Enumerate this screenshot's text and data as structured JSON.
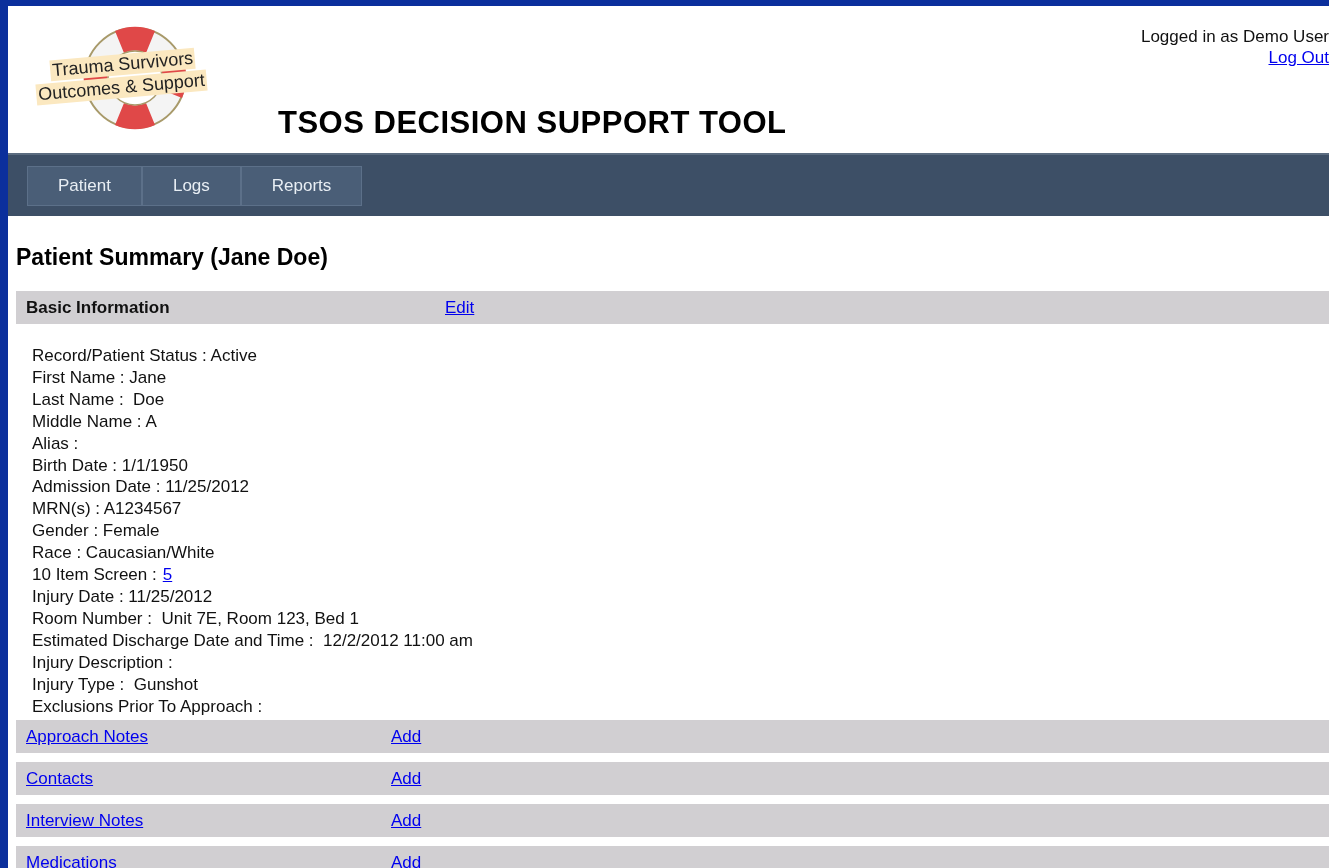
{
  "logo": {
    "line_1": "Trauma Survivors",
    "line_2": "Outcomes & Support"
  },
  "title": "TSOS DECISION SUPPORT TOOL",
  "user": {
    "status": "Logged in as Demo User",
    "logout": "Log Out"
  },
  "nav": [
    {
      "label": "Patient"
    },
    {
      "label": "Logs"
    },
    {
      "label": "Reports"
    }
  ],
  "heading": "Patient Summary (Jane Doe)",
  "basic_info": {
    "title": "Basic Information",
    "action": "Edit",
    "fields": [
      {
        "text": "Record/Patient Status : Active"
      },
      {
        "text": "First Name : Jane"
      },
      {
        "text": "Last Name :  Doe"
      },
      {
        "text": "Middle Name : A"
      },
      {
        "text": "Alias :"
      },
      {
        "text": "Birth Date : 1/1/1950"
      },
      {
        "text": "Admission Date : 11/25/2012"
      },
      {
        "text": "MRN(s) : A1234567"
      },
      {
        "text": "Gender : Female"
      },
      {
        "text": "Race : Caucasian/White"
      },
      {
        "text": "10 Item Screen :",
        "link": "5"
      },
      {
        "text": "Injury Date : 11/25/2012"
      },
      {
        "text": "Room Number :  Unit 7E, Room 123, Bed 1"
      },
      {
        "text": "Estimated Discharge Date and Time :  12/2/2012 11:00 am"
      },
      {
        "text": "Injury Description :"
      },
      {
        "text": "Injury Type :  Gunshot"
      },
      {
        "text": "Exclusions Prior To Approach :"
      }
    ]
  },
  "sections": [
    {
      "title": "Approach Notes",
      "action": "Add"
    },
    {
      "title": "Contacts",
      "action": "Add"
    },
    {
      "title": "Interview Notes",
      "action": "Add"
    },
    {
      "title": "Medications",
      "action": "Add"
    }
  ]
}
